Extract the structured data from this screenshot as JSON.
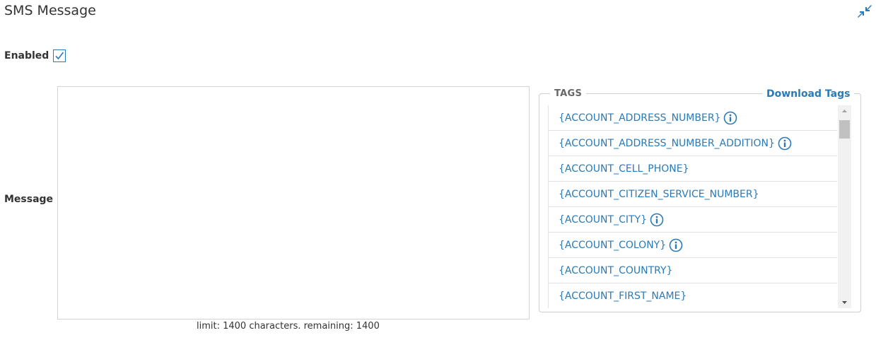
{
  "header": {
    "title": "SMS Message",
    "collapse_icon": "compress-arrows-icon"
  },
  "enabled": {
    "label": "Enabled",
    "checked": true
  },
  "message": {
    "label": "Message",
    "value": "",
    "limit_text": "limit: 1400 characters. remaining: 1400"
  },
  "tags": {
    "legend": "TAGS",
    "download_label": "Download Tags",
    "items": [
      {
        "label": "{ACCOUNT_ADDRESS_NUMBER}",
        "info": true
      },
      {
        "label": "{ACCOUNT_ADDRESS_NUMBER_ADDITION}",
        "info": true
      },
      {
        "label": "{ACCOUNT_CELL_PHONE}",
        "info": false
      },
      {
        "label": "{ACCOUNT_CITIZEN_SERVICE_NUMBER}",
        "info": false
      },
      {
        "label": "{ACCOUNT_CITY}",
        "info": true
      },
      {
        "label": "{ACCOUNT_COLONY}",
        "info": true
      },
      {
        "label": "{ACCOUNT_COUNTRY}",
        "info": false
      },
      {
        "label": "{ACCOUNT_FIRST_NAME}",
        "info": false
      }
    ]
  },
  "colors": {
    "accent": "#2a7ab8",
    "text": "#333333",
    "border": "#d4d4d4"
  }
}
